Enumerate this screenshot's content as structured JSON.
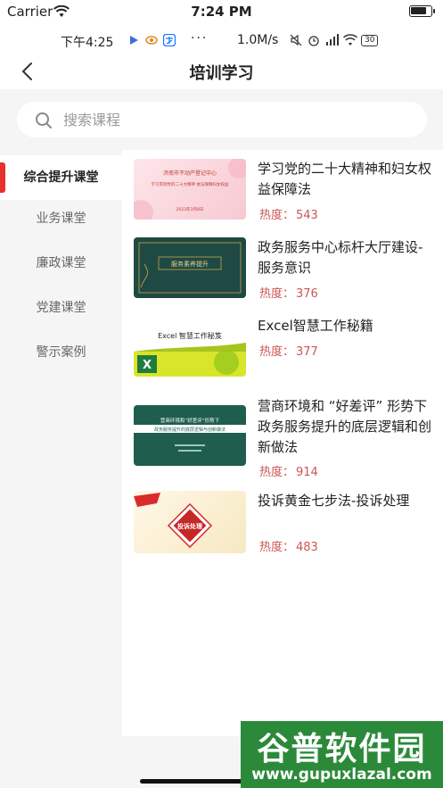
{
  "ios_status": {
    "carrier": "Carrier",
    "time": "7:24 PM"
  },
  "android_status": {
    "time": "下午4:25",
    "dots": "···",
    "speed": "1.0M/s",
    "battery": "30"
  },
  "nav": {
    "title": "培训学习"
  },
  "search": {
    "placeholder": "搜索课程"
  },
  "sidebar": {
    "items": [
      {
        "label": "综合提升课堂",
        "active": true
      },
      {
        "label": "业务课堂"
      },
      {
        "label": "廉政课堂"
      },
      {
        "label": "党建课堂"
      },
      {
        "label": "警示案例"
      }
    ]
  },
  "heat_label": "热度：",
  "courses": [
    {
      "title": "学习党的二十大精神和妇女权益保障法",
      "heat": "543",
      "thumb": {
        "line1": "济南市不动产登记中心",
        "line2": "学习贯彻党的二十大精神 依法保障妇女权益",
        "line3": "2023年3月8日"
      }
    },
    {
      "title": "政务服务中心标杆大厅建设-服务意识",
      "heat": "376",
      "thumb": {
        "line1": "服务素养提升"
      }
    },
    {
      "title": "Excel智慧工作秘籍",
      "heat": "377",
      "thumb": {
        "line1": "Excel 智慧工作秘笈"
      }
    },
    {
      "title": "营商环境和 “好差评” 形势下政务服务提升的底层逻辑和创新做法",
      "heat": "914",
      "thumb": {
        "line1": "营商环境和“好差评”形势下",
        "line2": "政务服务提升的底层逻辑与创新做法"
      }
    },
    {
      "title": "投诉黄金七步法-投诉处理",
      "heat": "483",
      "thumb": {
        "line1": "投诉处理"
      }
    }
  ],
  "watermark": {
    "main": "谷普软件园",
    "url": "www.gupuxlazal.com"
  }
}
